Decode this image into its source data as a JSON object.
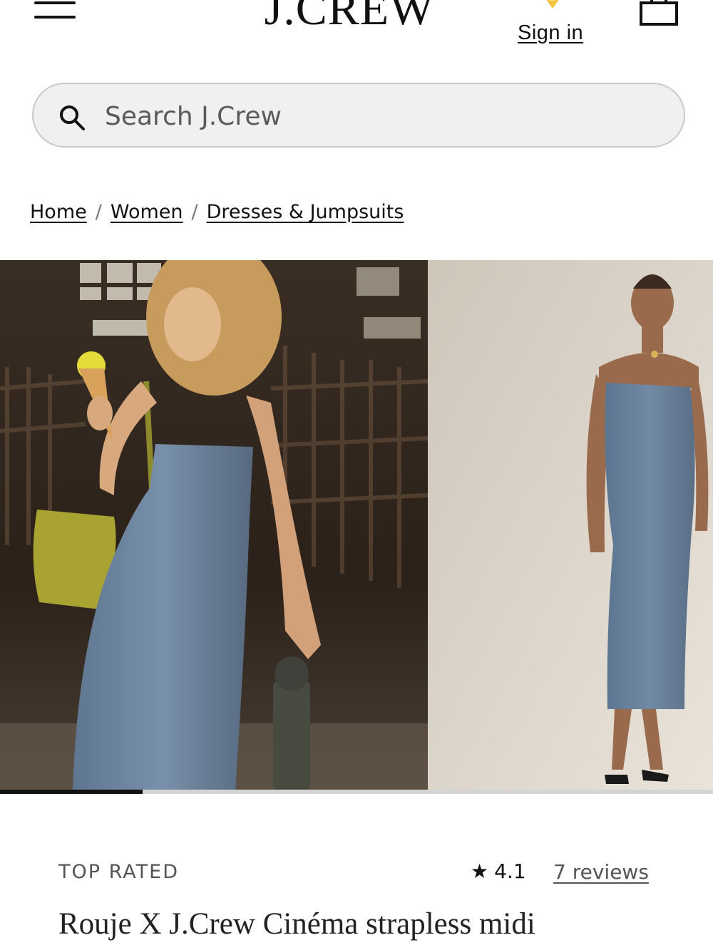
{
  "header": {
    "logo": "J.CREW",
    "sign_in": "Sign in",
    "menu_icon": "hamburger-menu-icon",
    "location_icon": "location-pin-icon",
    "bag_icon": "shopping-bag-icon"
  },
  "search": {
    "placeholder": "Search J.Crew",
    "value": "",
    "icon": "search-icon"
  },
  "breadcrumb": {
    "items": [
      "Home",
      "Women",
      "Dresses & Jumpsuits"
    ],
    "separator": "/"
  },
  "gallery": {
    "images": [
      "lifestyle-photo",
      "studio-photo"
    ],
    "progress": 0.2
  },
  "product": {
    "badge": "TOP RATED",
    "rating_star": "★",
    "rating": "4.1",
    "reviews": "7 reviews",
    "title": "Rouje X J.Crew Cinéma strapless midi"
  },
  "colors": {
    "accent_yellow": "#f3c43a",
    "dress_blue": "#6f87a1",
    "text": "#111111",
    "muted": "#555555"
  }
}
